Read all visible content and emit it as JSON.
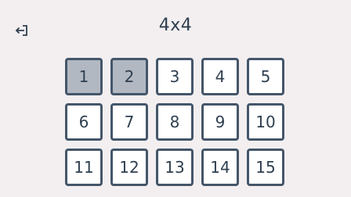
{
  "header": {
    "title": "4x4",
    "back_icon": "exit-arrow-icon"
  },
  "tiles": [
    {
      "label": "1",
      "selected": true
    },
    {
      "label": "2",
      "selected": true
    },
    {
      "label": "3",
      "selected": false
    },
    {
      "label": "4",
      "selected": false
    },
    {
      "label": "5",
      "selected": false
    },
    {
      "label": "6",
      "selected": false
    },
    {
      "label": "7",
      "selected": false
    },
    {
      "label": "8",
      "selected": false
    },
    {
      "label": "9",
      "selected": false
    },
    {
      "label": "10",
      "selected": false
    },
    {
      "label": "11",
      "selected": false
    },
    {
      "label": "12",
      "selected": false
    },
    {
      "label": "13",
      "selected": false
    },
    {
      "label": "14",
      "selected": false
    },
    {
      "label": "15",
      "selected": false
    }
  ],
  "colors": {
    "background": "#f3eff0",
    "tile_border": "#44566a",
    "tile_fill": "#ffffff",
    "tile_selected_fill": "#b2b8c2",
    "text": "#2f3f50"
  }
}
